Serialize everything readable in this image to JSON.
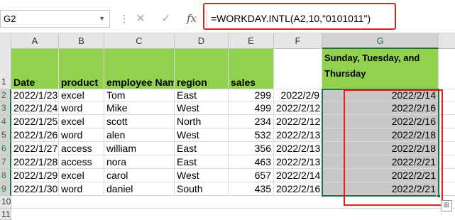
{
  "formula_bar": {
    "name_box": "G2",
    "cancel_icon": "✕",
    "enter_icon": "✓",
    "fx_icon": "fx",
    "formula": "=WORKDAY.INTL(A2,10,\"0101011\")"
  },
  "columns": [
    "A",
    "B",
    "C",
    "D",
    "E",
    "F",
    "G"
  ],
  "rows": [
    "1",
    "2",
    "3",
    "4",
    "5",
    "6",
    "7",
    "8",
    "9",
    "10",
    "11"
  ],
  "headers": {
    "date": "Date",
    "product": "product",
    "employee": "employee Nam",
    "region": "region",
    "sales": "sales",
    "g_title": "Sunday, Tuesday, and Thursday"
  },
  "data": [
    {
      "date": "2022/1/23",
      "product": "excel",
      "employee": "Tom",
      "region": "East",
      "sales": "299",
      "f": "2022/2/9",
      "g": "2022/2/14"
    },
    {
      "date": "2022/1/24",
      "product": "word",
      "employee": "Mike",
      "region": "West",
      "sales": "499",
      "f": "2022/2/12",
      "g": "2022/2/16"
    },
    {
      "date": "2022/1/25",
      "product": "excel",
      "employee": "scott",
      "region": "North",
      "sales": "234",
      "f": "2022/2/12",
      "g": "2022/2/16"
    },
    {
      "date": "2022/1/26",
      "product": "word",
      "employee": "alen",
      "region": "West",
      "sales": "532",
      "f": "2022/2/13",
      "g": "2022/2/18"
    },
    {
      "date": "2022/1/27",
      "product": "access",
      "employee": "william",
      "region": "East",
      "sales": "356",
      "f": "2022/2/13",
      "g": "2022/2/18"
    },
    {
      "date": "2022/1/28",
      "product": "access",
      "employee": "nora",
      "region": "East",
      "sales": "463",
      "f": "2022/2/13",
      "g": "2022/2/21"
    },
    {
      "date": "2022/1/29",
      "product": "excel",
      "employee": "carol",
      "region": "West",
      "sales": "657",
      "f": "2022/2/14",
      "g": "2022/2/21"
    },
    {
      "date": "2022/1/30",
      "product": "word",
      "employee": "daniel",
      "region": "South",
      "sales": "435",
      "f": "2022/2/16",
      "g": "2022/2/21"
    }
  ],
  "colors": {
    "header_green": "#92d050",
    "selection_gray": "#c8c8c8",
    "excel_green": "#217346",
    "annotation_red": "#e02020"
  }
}
